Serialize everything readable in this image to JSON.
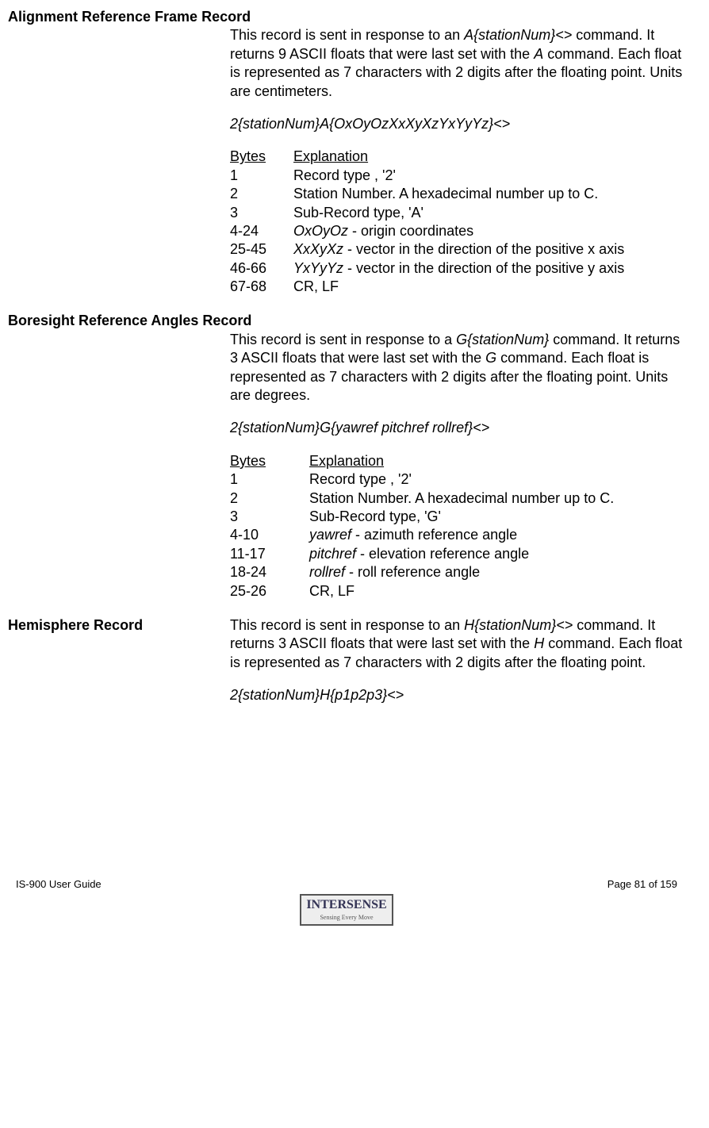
{
  "sections": [
    {
      "title": "Alignment Reference Frame Record",
      "intro": {
        "pre": "This record is sent in response to an ",
        "cmd": "A{stationNum}<>",
        "mid": " command.  It returns 9 ASCII floats that were last set with the ",
        "cmd2": "A",
        "post": " command. Each float is represented as 7 characters with 2 digits after the floating point. Units are centimeters."
      },
      "syntax": "2{stationNum}A{OxOyOzXxXyXzYxYyYz}<>",
      "header": {
        "bytes": "Bytes",
        "explanation": "Explanation"
      },
      "colClass": "byte-col1",
      "rows": [
        {
          "b": "1",
          "e_pre": "Record type , '2'"
        },
        {
          "b": "2",
          "e_pre": "Station Number. A hexadecimal number up to C."
        },
        {
          "b": "3",
          "e_pre": "Sub-Record type, 'A'"
        },
        {
          "b": "4-24",
          "e_italic": "OxOyOz",
          "e_post": " - origin coordinates"
        },
        {
          "b": "25-45",
          "e_italic": "XxXyXz",
          "e_post": " - vector in the direction of the positive x axis"
        },
        {
          "b": "46-66",
          "e_italic": " YxYyYz",
          "e_post": " - vector in the direction of the positive y axis"
        },
        {
          "b": "67-68",
          "e_pre": "CR, LF"
        }
      ]
    },
    {
      "title": "Boresight Reference Angles Record",
      "intro": {
        "pre": "This record is sent in response to a ",
        "cmd": "G{stationNum}",
        "mid": " command. It returns 3 ASCII floats that were last set with the ",
        "cmd2": "G",
        "post": " command. Each float is represented as 7 characters with 2 digits after the floating point. Units are degrees."
      },
      "syntax": "2{stationNum}G{yawref pitchref rollref}<>",
      "header": {
        "bytes": "Bytes",
        "explanation": "Explanation"
      },
      "colClass": "byte-col1-wide",
      "rows": [
        {
          "b": "1",
          "e_pre": "Record type , '2'"
        },
        {
          "b": "2",
          "e_pre": "Station Number. A hexadecimal number up to C."
        },
        {
          "b": "3",
          "e_pre": "Sub-Record type, 'G'"
        },
        {
          "b": "4-10",
          "e_italic": "yawref",
          "e_post": " - azimuth reference angle"
        },
        {
          "b": "11-17",
          "e_italic": "pitchref",
          "e_post": " - elevation reference angle"
        },
        {
          "b": "18-24",
          "e_italic": "rollref",
          "e_post": " - roll reference angle"
        },
        {
          "b": "25-26",
          "e_pre": "CR, LF"
        }
      ]
    },
    {
      "title": "Hemisphere Record",
      "inline": true,
      "intro": {
        "pre": "This record is sent in response to an ",
        "cmd": "H{stationNum}<>",
        "mid": " command.  It returns 3 ASCII floats that were last set with the ",
        "cmd2": "H",
        "post": " command. Each float is represented as 7 characters with 2 digits after the floating point."
      },
      "syntax": "2{stationNum}H{p1p2p3}<>"
    }
  ],
  "footer": {
    "left": "IS-900 User Guide",
    "right": "Page 81 of 159",
    "logo": "INTERSENSE",
    "logoSub": "Sensing Every Move"
  }
}
